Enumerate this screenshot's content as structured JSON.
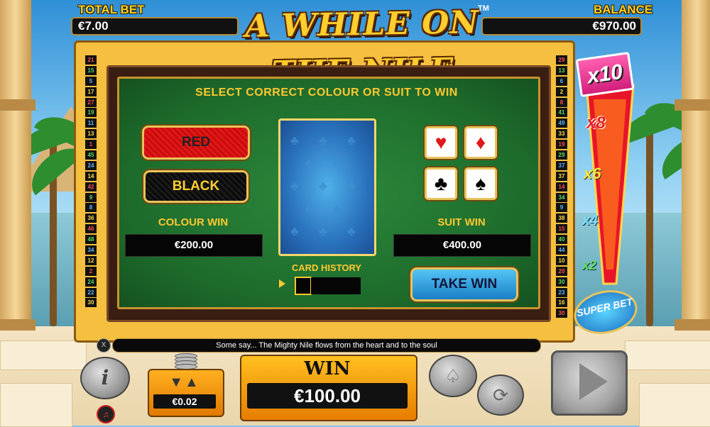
{
  "game": {
    "title": "A WHILE ON THE NILE",
    "trademark": "TM"
  },
  "meters": {
    "total_bet_label": "TOTAL BET",
    "total_bet_value": "€7.00",
    "balance_label": "BALANCE",
    "balance_value": "€970.00"
  },
  "paylines": {
    "left": [
      "21",
      "15",
      "5",
      "17",
      "27",
      "19",
      "11",
      "13",
      "1",
      "45",
      "24",
      "14",
      "42",
      "9",
      "8",
      "36",
      "46",
      "48",
      "34",
      "12",
      "2",
      "24",
      "22",
      "30"
    ],
    "right": [
      "29",
      "13",
      "6",
      "2",
      "8",
      "41",
      "49",
      "33",
      "19",
      "29",
      "37",
      "37",
      "14",
      "34",
      "9",
      "38",
      "15",
      "40",
      "44",
      "10",
      "20",
      "30",
      "23",
      "16",
      "30"
    ]
  },
  "gamble": {
    "title": "SELECT CORRECT COLOUR OR SUIT TO WIN",
    "red_label": "RED",
    "black_label": "BLACK",
    "colour_win_label": "COLOUR WIN",
    "colour_win_value": "€200.00",
    "suit_win_label": "SUIT WIN",
    "suit_win_value": "€400.00",
    "card_history_label": "CARD HISTORY",
    "take_win_label": "TAKE WIN",
    "suits": [
      {
        "symbol": "♥",
        "color": "#e01818"
      },
      {
        "symbol": "♦",
        "color": "#e01818"
      },
      {
        "symbol": "♣",
        "color": "#000000"
      },
      {
        "symbol": "♠",
        "color": "#000000"
      }
    ]
  },
  "multipliers": [
    "x10",
    "x8",
    "x6",
    "x4",
    "x2"
  ],
  "superbet_label": "SUPER BET",
  "message": "Some say... The Mighty Nile flows from the heart and to the soul",
  "controls": {
    "close_glyph": "X",
    "info_glyph": "i",
    "stake_value": "€0.02",
    "win_label": "WIN",
    "win_value": "€100.00"
  },
  "colors": {
    "accent_gold": "#ffc830",
    "felt_green": "#1d6a2b",
    "take_win_blue": "#1b7fc6"
  }
}
